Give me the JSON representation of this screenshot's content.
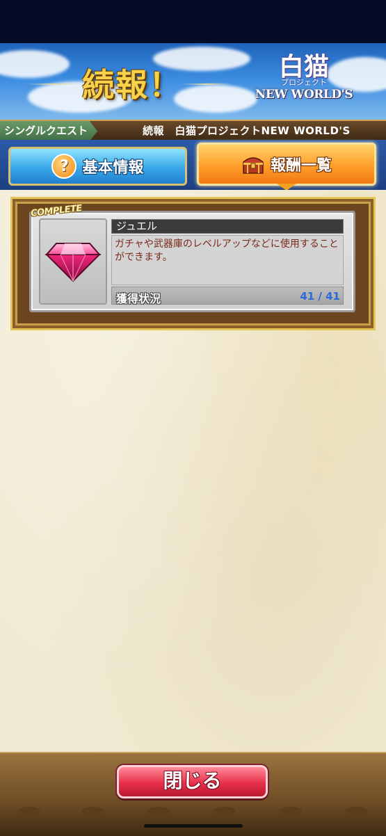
{
  "banner": {
    "title": "続報！",
    "logo_kanji": "白猫",
    "logo_sub": "プロジェクト",
    "logo_en": "NEW WORLD'S"
  },
  "quest_bar": {
    "category": "シングルクエスト",
    "title": "続報　白猫プロジェクトNEW WORLD'S"
  },
  "tabs": [
    {
      "label": "基本情報",
      "icon": "question-icon",
      "selected": false
    },
    {
      "label": "報酬一覧",
      "icon": "treasure-chest-icon",
      "selected": true
    }
  ],
  "reward": {
    "badge": "COMPLETE",
    "icon": "jewel-icon",
    "name": "ジュエル",
    "description": "ガチャや武器庫のレベルアップなどに使用することができます。",
    "status_label": "獲得状況",
    "status_value": "41 / 41"
  },
  "footer": {
    "close_label": "閉じる"
  },
  "colors": {
    "tab_selected": "#f27a12",
    "tab_unselected": "#3aa8e8",
    "close_button": "#e8304a",
    "status_value": "#2a6ad8"
  }
}
